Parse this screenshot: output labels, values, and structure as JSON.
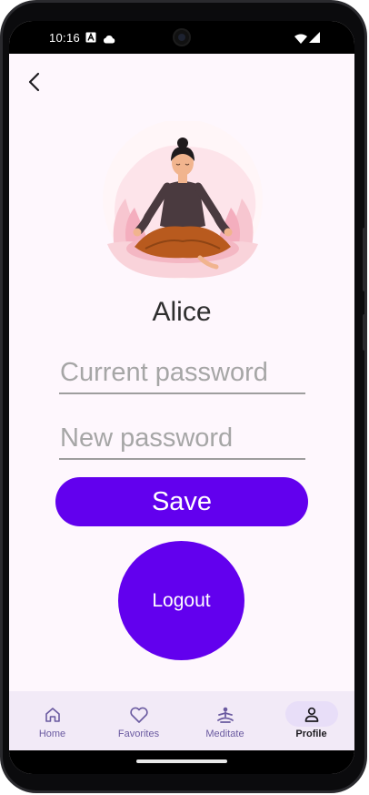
{
  "status_bar": {
    "time": "10:16"
  },
  "profile": {
    "name": "Alice"
  },
  "form": {
    "current_password_placeholder": "Current password",
    "new_password_placeholder": "New password",
    "save_label": "Save",
    "logout_label": "Logout"
  },
  "bottom_nav": {
    "items": [
      {
        "label": "Home",
        "icon": "home-icon"
      },
      {
        "label": "Favorites",
        "icon": "heart-icon"
      },
      {
        "label": "Meditate",
        "icon": "meditate-icon"
      },
      {
        "label": "Profile",
        "icon": "person-icon",
        "selected": true
      }
    ]
  },
  "colors": {
    "accent": "#6200ee",
    "background": "#fef7fd",
    "nav_background": "#f2eaf7",
    "nav_pill": "#e8def8"
  }
}
